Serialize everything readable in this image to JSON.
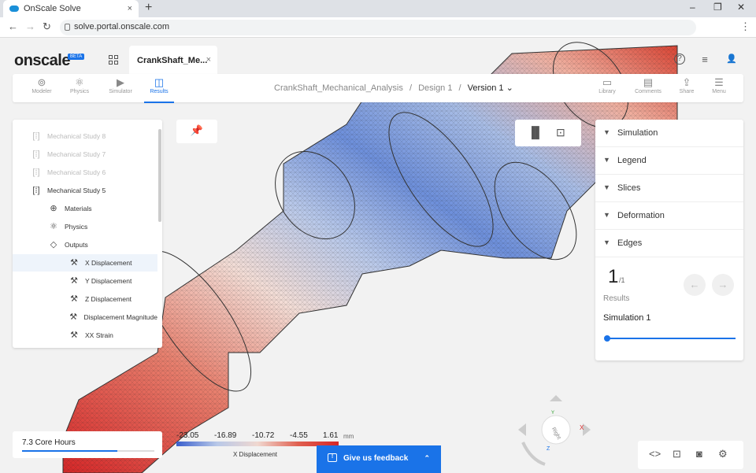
{
  "browser": {
    "tab_title": "OnScale Solve",
    "tab_close": "×",
    "new_tab": "+",
    "url": "solve.portal.onscale.com",
    "min_glyph": "–",
    "max_glyph": "❐",
    "close_glyph": "✕",
    "back_glyph": "←",
    "forward_glyph": "→",
    "reload_glyph": "↻",
    "menu_glyph": "⋮"
  },
  "app": {
    "logo": "onscale",
    "beta": "BETA",
    "file_tab": "CrankShaft_Me...",
    "file_tab_close": "×",
    "help_glyph": "?",
    "settings_glyph": "≡",
    "user_glyph": "👤"
  },
  "toolbar": {
    "modeler": "Modeler",
    "physics": "Physics",
    "simulator": "Simulator",
    "results": "Results",
    "library": "Library",
    "comments": "Comments",
    "share": "Share",
    "menu": "Menu"
  },
  "breadcrumb": {
    "project": "CrankShaft_Mechanical_Analysis",
    "sep1": "/",
    "design": "Design 1",
    "sep2": "/",
    "version": "Version 1",
    "chevron": "⌄"
  },
  "tree": {
    "items": [
      {
        "label": "Mechanical Study 8",
        "icon": "study-icon"
      },
      {
        "label": "Mechanical Study 7",
        "icon": "study-icon"
      },
      {
        "label": "Mechanical Study 6",
        "icon": "study-icon"
      },
      {
        "label": "Mechanical Study 5",
        "icon": "study-icon"
      },
      {
        "label": "Materials",
        "icon": "materials-icon"
      },
      {
        "label": "Physics",
        "icon": "physics-icon"
      },
      {
        "label": "Outputs",
        "icon": "outputs-icon"
      },
      {
        "label": "X Displacement",
        "icon": "wrench-icon"
      },
      {
        "label": "Y Displacement",
        "icon": "wrench-icon"
      },
      {
        "label": "Z Displacement",
        "icon": "wrench-icon"
      },
      {
        "label": "Displacement Magnitude",
        "icon": "wrench-icon"
      },
      {
        "label": "XX Strain",
        "icon": "wrench-icon"
      }
    ]
  },
  "right_panel": {
    "sections": [
      "Simulation",
      "Legend",
      "Slices",
      "Deformation",
      "Edges"
    ],
    "result_number": "1",
    "result_total": "/1",
    "results_label": "Results",
    "simulation_name": "Simulation 1",
    "prev_glyph": "←",
    "next_glyph": "→",
    "slider_value": 0
  },
  "core_hours": {
    "label": "7.3 Core Hours",
    "usage_fraction": 0.72
  },
  "legend": {
    "ticks": [
      "-23.05",
      "-16.89",
      "-10.72",
      "-4.55",
      "1.61"
    ],
    "unit": "mm",
    "label": "X Displacement"
  },
  "feedback": {
    "label": "Give us feedback",
    "icon_glyph": "!",
    "expand_glyph": "⌃"
  },
  "navcube": {
    "face": "Right",
    "x_axis": "X",
    "y_axis": "Y",
    "z_axis": "Z"
  },
  "colors": {
    "accent": "#1a73e8",
    "mesh_red": "#d62728",
    "mesh_blue": "#3a5fcd"
  }
}
